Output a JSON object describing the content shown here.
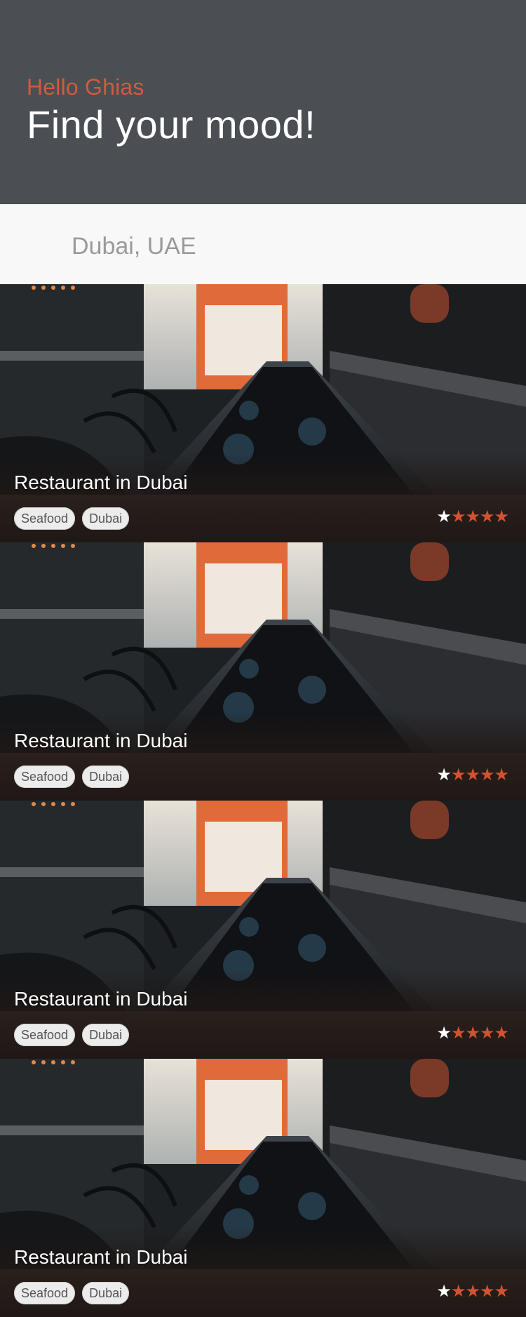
{
  "header": {
    "greeting": "Hello Ghias",
    "headline": "Find your mood!"
  },
  "search": {
    "value": "Dubai, UAE",
    "location_icon": "map-pin-icon",
    "search_icon": "search-icon"
  },
  "colors": {
    "accent": "#d2532f",
    "header_bg": "#4b4e53",
    "search_bg": "#f8f8f8"
  },
  "restaurants": [
    {
      "title": "Restaurant in Dubai",
      "tags": [
        "Seafood",
        "Dubai"
      ],
      "rating": 4
    },
    {
      "title": "Restaurant in Dubai",
      "tags": [
        "Seafood",
        "Dubai"
      ],
      "rating": 4
    },
    {
      "title": "Restaurant in Dubai",
      "tags": [
        "Seafood",
        "Dubai"
      ],
      "rating": 4
    },
    {
      "title": "Restaurant in Dubai",
      "tags": [
        "Seafood",
        "Dubai"
      ],
      "rating": 4
    }
  ]
}
